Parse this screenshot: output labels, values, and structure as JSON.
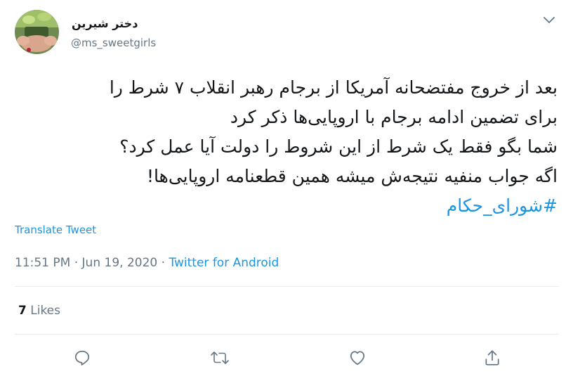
{
  "author": {
    "display_name": "دختر شیرین",
    "handle": "@ms_sweetgirls",
    "avatar_icon": "avatar-photo"
  },
  "tweet": {
    "lines": [
      "بعد از خروج مفتضحانه آمریکا از برجام رهبر انقلاب ۷ شرط را",
      "برای تضمین ادامه برجام با اروپایی‌ها ذکر کرد",
      "شما بگو فقط یک شرط از این شروط را دولت آیا عمل کرد؟",
      "اگه جواب منفیه نتیجه‌ش میشه همین قطعنامه اروپایی‌ها!"
    ],
    "hashtag": "#شورای_حکام"
  },
  "translate_label": "Translate Tweet",
  "meta": {
    "time": "11:51 PM",
    "separator1": " · ",
    "date": "Jun 19, 2020",
    "separator2": " · ",
    "source": "Twitter for Android"
  },
  "stats": {
    "likes_count": "7",
    "likes_label": " Likes"
  },
  "actions": [
    "reply-icon",
    "retweet-icon",
    "like-icon",
    "share-icon"
  ],
  "colors": {
    "link": "#1b95e0",
    "secondary_text": "#657786",
    "divider": "#e6ecf0",
    "primary_text": "#14171a"
  }
}
